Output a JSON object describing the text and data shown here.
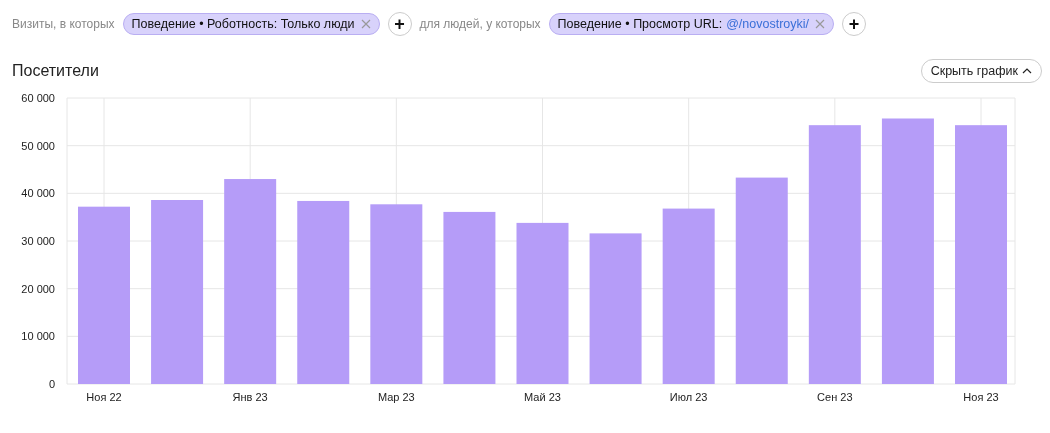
{
  "filters": {
    "visits_label": "Визиты, в которых",
    "visit_tag": {
      "text": "Поведение • Роботность: Только люди"
    },
    "people_label": "для людей, у которых",
    "people_tag": {
      "text": "Поведение • Просмотр URL: ",
      "value": "@/novostroyki/"
    },
    "add_buttons": [
      "+",
      "+"
    ]
  },
  "section": {
    "title": "Посетители",
    "toggle_button": "Скрыть график"
  },
  "chart_data": {
    "type": "bar",
    "grid": true,
    "categories": [
      "Ноя 22",
      null,
      "Янв 23",
      null,
      "Мар 23",
      null,
      "Май 23",
      null,
      "Июл 23",
      null,
      "Сен 23",
      null,
      "Ноя 23"
    ],
    "series": [
      {
        "color": "#b59cf8",
        "values": [
          37200,
          38600,
          43000,
          38400,
          37700,
          36100,
          33800,
          31600,
          36800,
          43300,
          54300,
          55700,
          54300
        ]
      }
    ],
    "ylim": [
      0,
      60000
    ],
    "yticks": [
      {
        "value": 0,
        "label": "0"
      },
      {
        "value": 10000,
        "label": "10 000"
      },
      {
        "value": 20000,
        "label": "20 000"
      },
      {
        "value": 30000,
        "label": "30 000"
      },
      {
        "value": 40000,
        "label": "40 000"
      },
      {
        "value": 50000,
        "label": "50 000"
      },
      {
        "value": 60000,
        "label": "60 000"
      }
    ]
  }
}
